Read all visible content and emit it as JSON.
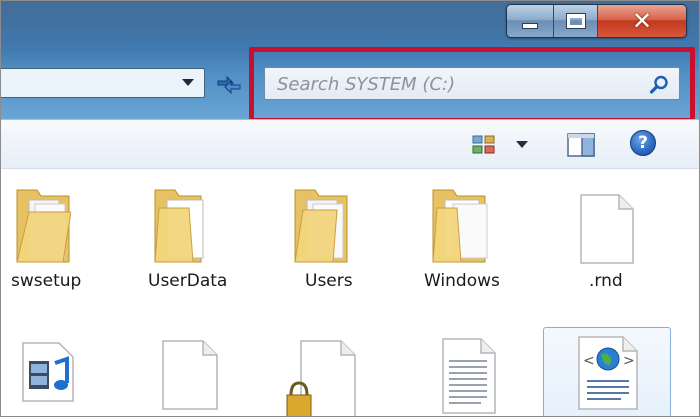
{
  "window": {
    "buttons": {
      "minimize": "minimize-icon",
      "maximize": "maximize-icon",
      "close": "close-icon"
    }
  },
  "address_bar": {
    "value": ""
  },
  "search": {
    "placeholder": "Search SYSTEM (C:)",
    "icon": "search-icon"
  },
  "toolbar": {
    "views_icon": "change-view-icon",
    "preview_icon": "preview-pane-icon",
    "help_icon": "help-icon",
    "help_label": "?"
  },
  "files": {
    "row1": [
      {
        "name": "swsetup",
        "type": "folder"
      },
      {
        "name": "UserData",
        "type": "folder"
      },
      {
        "name": "Users",
        "type": "folder"
      },
      {
        "name": "Windows",
        "type": "folder"
      },
      {
        "name": ".rnd",
        "type": "file"
      }
    ],
    "row2": [
      {
        "type": "media-file"
      },
      {
        "type": "file"
      },
      {
        "type": "locked-file"
      },
      {
        "type": "text-file"
      },
      {
        "type": "web-file"
      }
    ]
  },
  "colors": {
    "highlight": "#c8102e",
    "glass": "#4f8fc4"
  }
}
